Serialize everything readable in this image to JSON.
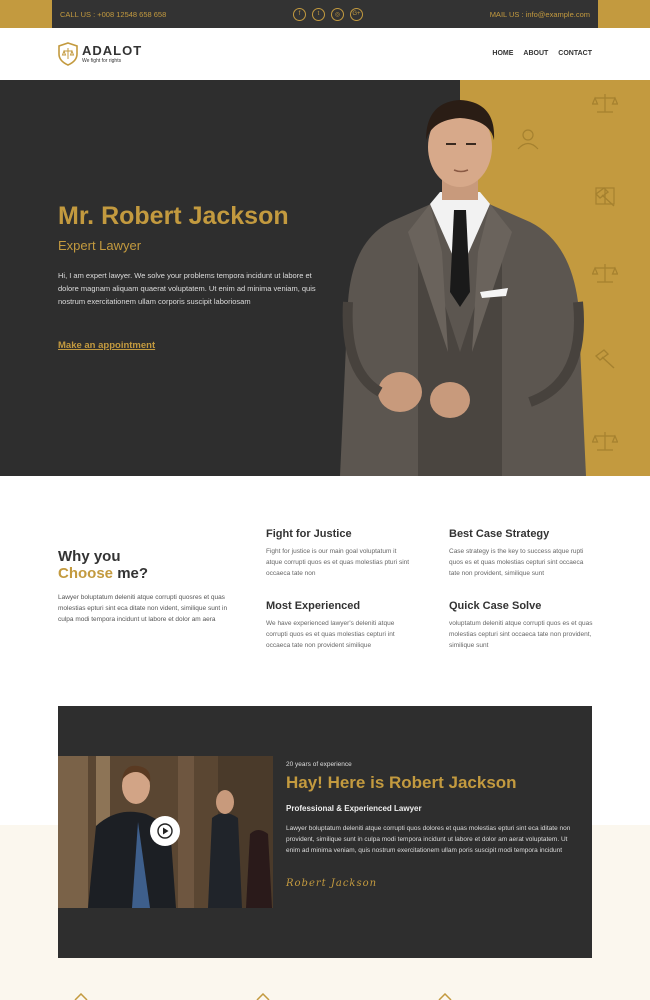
{
  "topbar": {
    "call_label": "CALL US :",
    "phone": "+008 12548 658 658",
    "mail_label": "MAIL US :",
    "email": "info@example.com",
    "social": [
      {
        "icon": "facebook-icon",
        "glyph": "f"
      },
      {
        "icon": "twitter-icon",
        "glyph": "t"
      },
      {
        "icon": "instagram-icon",
        "glyph": "◎"
      },
      {
        "icon": "google-plus-icon",
        "glyph": "G+"
      }
    ]
  },
  "brand": {
    "name": "ADALOT",
    "tagline": "We fight for rights"
  },
  "nav": {
    "items": [
      "HOME",
      "ABOUT",
      "CONTACT"
    ]
  },
  "hero": {
    "title": "Mr. Robert Jackson",
    "subtitle": "Expert Lawyer",
    "description": "Hi, I am expert lawyer. We solve your problems tempora incidunt ut labore et dolore magnam aliquam quaerat voluptatem. Ut enim ad minima veniam, quis nostrum exercitationem ullam corporis suscipit laboriosam",
    "cta": "Make an appointment"
  },
  "why": {
    "title_line1": "Why you",
    "title_highlight": "Choose",
    "title_rest": "me?",
    "description": "Lawyer boluptatum deleniti atque corrupti quosres et quas molestias epturi sint eca ditate non vident, similique sunt in culpa modi tempora incidunt ut labore et dolor am aera",
    "features": [
      {
        "title": "Fight for Justice",
        "text": "Fight for justice is our main goal voluptatum it atque corrupti quos es et quas molestias pturi sint occaeca tate non"
      },
      {
        "title": "Best Case Strategy",
        "text": "Case strategy is the key to success atque rupti quos es et quas molestias cepturi sint occaeca tate non provident, similique sunt"
      },
      {
        "title": "Most Experienced",
        "text": "We have experienced lawyer's deleniti atque corrupti quos es et quas molestias cepturi int occaeca tate non provident similique"
      },
      {
        "title": "Quick Case Solve",
        "text": "voluptatum deleniti atque corrupti quos es et quas molestias cepturi sint occaeca tate non provident, similique sunt"
      }
    ]
  },
  "about": {
    "experience": "20 years of experience",
    "title": "Hay! Here is Robert Jackson",
    "subtitle": "Professional & Experienced Lawyer",
    "description": "Lawyer boluptatum deleniti atque corrupti quos dolores et quas molestias epturi sint eca iditate non provident, similique sunt in culpa modi tempora incidunt ut labore et dolor am aerat voluptatem. Ut enim ad minima veniam, quis nostrum exercitationem ullam poris suscipit modi tempora incidunt",
    "signature": "Robert Jackson"
  },
  "colors": {
    "gold": "#c39a3f",
    "dark": "#2e2e2e",
    "cream": "#fbf7ee"
  }
}
